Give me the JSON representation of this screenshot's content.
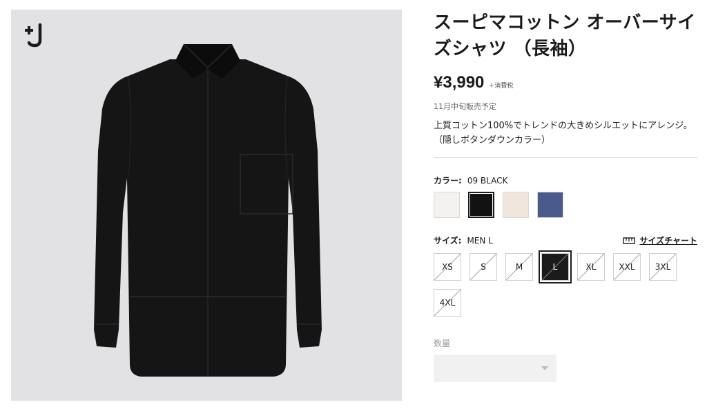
{
  "product": {
    "title": "スーピマコットン オーバーサイズシャツ （長袖）",
    "price": "¥3,990",
    "tax_note": "＋消費税",
    "release_note": "11月中旬販売予定",
    "description": "上質コットン100%でトレンドの大きめシルエットにアレンジ。（隠しボタンダウンカラー）"
  },
  "image": {
    "logo_text": "+J",
    "logo_icon": "plus-j-logo",
    "background": "#e2e2e4"
  },
  "color": {
    "label": "カラー:",
    "selected_value": "09 BLACK",
    "swatches": [
      {
        "name": "white",
        "hex": "#f3f2f1",
        "selected": false
      },
      {
        "name": "black",
        "hex": "#121212",
        "selected": true
      },
      {
        "name": "beige",
        "hex": "#f1e6dc",
        "selected": false
      },
      {
        "name": "navy",
        "hex": "#4a5a8a",
        "selected": false
      }
    ]
  },
  "size": {
    "label": "サイズ:",
    "selected_value": "MEN L",
    "chart_link": "サイズチャート",
    "chart_icon": "ruler-icon",
    "options": [
      {
        "label": "XS",
        "available": false,
        "selected": false
      },
      {
        "label": "S",
        "available": false,
        "selected": false
      },
      {
        "label": "M",
        "available": false,
        "selected": false
      },
      {
        "label": "L",
        "available": true,
        "selected": true
      },
      {
        "label": "XL",
        "available": false,
        "selected": false
      },
      {
        "label": "XXL",
        "available": false,
        "selected": false
      },
      {
        "label": "3XL",
        "available": false,
        "selected": false
      },
      {
        "label": "4XL",
        "available": false,
        "selected": false
      }
    ]
  },
  "quantity": {
    "label": "数量",
    "value": ""
  }
}
